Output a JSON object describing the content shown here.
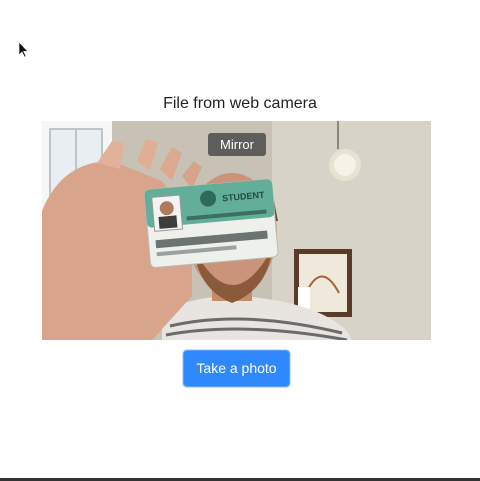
{
  "page": {
    "title": "File from web camera"
  },
  "camera": {
    "mirror_label": "Mirror",
    "card_header_text": "STUDENT"
  },
  "actions": {
    "take_photo_label": "Take a photo"
  },
  "colors": {
    "primary_button": "#2f89fc",
    "overlay_button": "#4b4b4b"
  },
  "icons": {
    "cursor": "mouse-pointer-icon"
  }
}
